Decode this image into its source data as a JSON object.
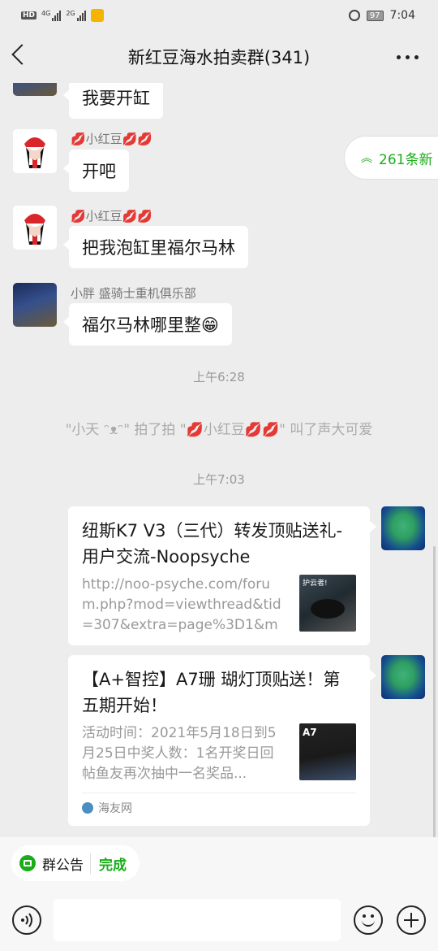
{
  "status_bar": {
    "badge": "HD",
    "network1": "4G",
    "network2": "2G",
    "battery": "97",
    "time": "7:04"
  },
  "header": {
    "title": "新红豆海水拍卖群(341)"
  },
  "new_messages_pill": {
    "label": "261条新"
  },
  "messages": [
    {
      "sender": "",
      "text": "我要开缸"
    },
    {
      "sender": "💋小红豆💋💋",
      "text": "开吧"
    },
    {
      "sender": "💋小红豆💋💋",
      "text": "把我泡缸里福尔马林"
    },
    {
      "sender": "小胖  盛骑士重机俱乐部",
      "text": "福尔马林哪里整😁"
    }
  ],
  "time_1": "上午6:28",
  "system_message": "\"小天 ᵔᴥᵔ\" 拍了拍 \"💋小红豆💋💋\" 叫了声大可爱",
  "time_2": "上午7:03",
  "cards": [
    {
      "title": "纽斯K7 V3（三代）转发顶贴送礼- 用户交流-Noopsyche",
      "desc": "http://noo-psyche.com/forum.php?mod=viewthread&tid=307&extra=page%3D1&mo...",
      "thumb_text": "护云者!",
      "source": ""
    },
    {
      "title": "【A+智控】A7珊 瑚灯顶贴送！第五期开始！",
      "desc": "活动时间：2021年5月18日到5月25日中奖人数：1名开奖日回帖鱼友再次抽中一名奖品...",
      "thumb_text": "A7",
      "source": "海友网"
    }
  ],
  "announcement": {
    "label": "群公告",
    "done": "完成"
  },
  "input": {
    "placeholder": ""
  }
}
